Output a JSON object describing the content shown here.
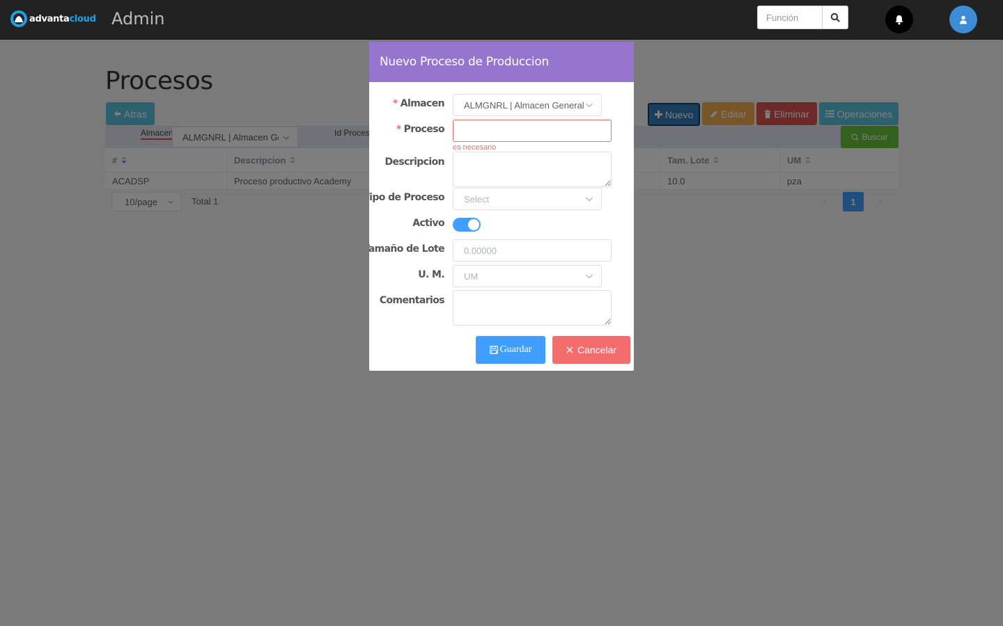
{
  "app": {
    "logo_text_a": "advanta",
    "logo_text_b": "cloud",
    "title": "Admin",
    "search_placeholder": "Función",
    "accent_color": "#409eff",
    "icons": [
      "search-icon",
      "bell-icon",
      "user-icon"
    ]
  },
  "page": {
    "title": "Procesos",
    "toolbar": {
      "back": "Atras",
      "new": "Nuevo",
      "edit": "Editar",
      "delete": "Eliminar",
      "operations": "Operaciones"
    },
    "filters": {
      "almacen_label": "Almacen",
      "almacen_value": "ALMGNRL | Almacen General",
      "id_proceso_label": "Id Proceso",
      "search_button": "Buscar"
    },
    "table": {
      "columns": [
        "#",
        "Descripcion",
        "Tam. Lote",
        "UM"
      ],
      "rows": [
        [
          "ACADSP",
          "Proceso productivo Academy",
          "10.0",
          "pza"
        ]
      ]
    },
    "pagination": {
      "page_size": "10/page",
      "total": "Total 1",
      "current_page": "1"
    }
  },
  "modal": {
    "title": "Nuevo Proceso de Produccion",
    "fields": {
      "almacen_label": "Almacen",
      "almacen_value": "ALMGNRL | Almacen General",
      "proceso_label": "Proceso",
      "proceso_value": "",
      "proceso_error": "es necesario",
      "descripcion_label": "Descripcion",
      "tipo_label": "Tipo de Proceso",
      "tipo_placeholder": "Select",
      "activo_label": "Activo",
      "activo_on": true,
      "lote_label": "Tamaño de Lote",
      "lote_placeholder": "0.00000",
      "um_label": "U. M.",
      "um_placeholder": "UM",
      "comentarios_label": "Comentarios"
    },
    "save": "Guardar",
    "cancel": "Cancelar"
  }
}
